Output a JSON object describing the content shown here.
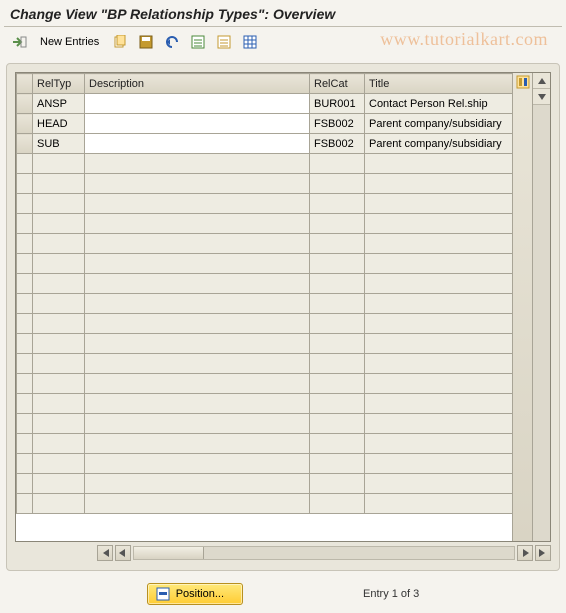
{
  "title": "Change View \"BP Relationship Types\": Overview",
  "toolbar": {
    "new_entries": "New Entries"
  },
  "watermark": "www.tutorialkart.com",
  "columns": {
    "reltyp": "RelTyp",
    "description": "Description",
    "relcat": "RelCat",
    "title": "Title"
  },
  "rows": [
    {
      "reltyp": "ANSP",
      "description": "",
      "relcat": "BUR001",
      "title": "Contact Person Rel.ship"
    },
    {
      "reltyp": "HEAD",
      "description": "",
      "relcat": "FSB002",
      "title": "Parent company/subsidiary"
    },
    {
      "reltyp": "SUB",
      "description": "",
      "relcat": "FSB002",
      "title": "Parent company/subsidiary"
    }
  ],
  "empty_rows": 18,
  "footer": {
    "position": "Position...",
    "entry_text": "Entry 1 of 3"
  }
}
